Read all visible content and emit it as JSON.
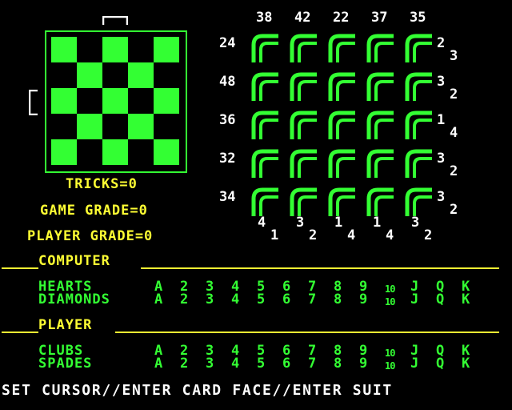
{
  "board_caption": {
    "tricks": "TRICKS=0",
    "game_grade": "GAME GRADE=0",
    "player_grade": "PLAYER GRADE=0"
  },
  "column_headers": [
    "38",
    "42",
    "22",
    "37",
    "35"
  ],
  "row_headers": [
    "24",
    "48",
    "36",
    "32",
    "34"
  ],
  "right_pairs": [
    [
      "2",
      "3"
    ],
    [
      "3",
      "2"
    ],
    [
      "1",
      "4"
    ],
    [
      "3",
      "2"
    ],
    [
      "3",
      "2"
    ]
  ],
  "bottom_pairs": [
    [
      "4",
      "1"
    ],
    [
      "3",
      "2"
    ],
    [
      "1",
      "4"
    ],
    [
      "1",
      "4"
    ],
    [
      "3",
      "2"
    ]
  ],
  "computer": {
    "label": "COMPUTER",
    "suits": [
      "HEARTS",
      "DIAMONDS"
    ]
  },
  "player": {
    "label": "PLAYER",
    "suits": [
      "CLUBS",
      "SPADES"
    ]
  },
  "card_faces": [
    "A",
    "2",
    "3",
    "4",
    "5",
    "6",
    "7",
    "8",
    "9",
    "10",
    "J",
    "Q",
    "K"
  ],
  "status_line": "SET CURSOR//ENTER CARD FACE//ENTER SUIT",
  "colors": {
    "yellow": "#ffff33",
    "green": "#33ff33",
    "white": "#ffffff",
    "background": "#000000"
  }
}
